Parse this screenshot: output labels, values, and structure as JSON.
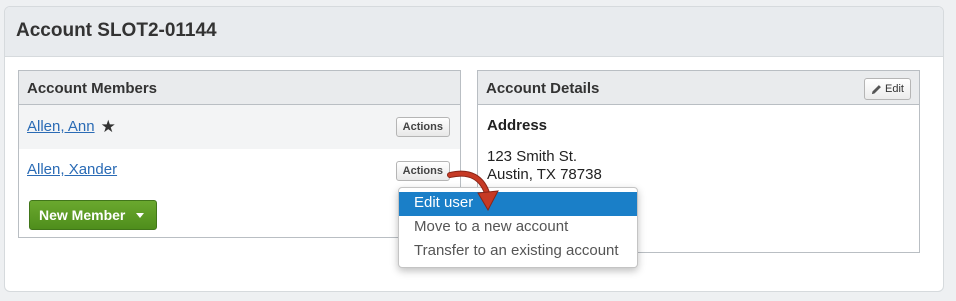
{
  "page": {
    "title": "Account SLOT2-01144"
  },
  "members_panel": {
    "title": "Account Members",
    "members": [
      {
        "name": "Allen, Ann",
        "primary": true,
        "actions_label": "Actions"
      },
      {
        "name": "Allen, Xander",
        "primary": false,
        "actions_label": "Actions"
      }
    ],
    "new_member_label": "New Member"
  },
  "details_panel": {
    "title": "Account Details",
    "edit_label": "Edit",
    "address_title": "Address",
    "address_line1": "123 Smith St.",
    "address_line2": "Austin, TX 78738"
  },
  "actions_menu": {
    "items": [
      {
        "label": "Edit user",
        "highlighted": true
      },
      {
        "label": "Move to a new account",
        "highlighted": false
      },
      {
        "label": "Transfer to an existing account",
        "highlighted": false
      }
    ]
  },
  "colors": {
    "link": "#2a6bb5",
    "new_member_button": "#5a9a22",
    "menu_highlight": "#1a7fc8",
    "annotation_arrow": "#b8321f"
  },
  "icons": {
    "primary_member": "star-icon",
    "edit": "pencil-icon",
    "dropdown": "caret-down-icon"
  }
}
